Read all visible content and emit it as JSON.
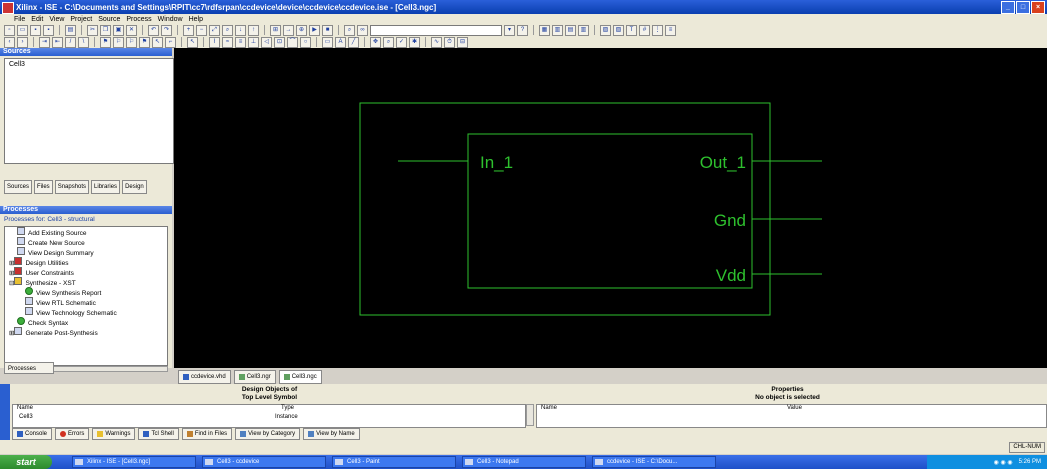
{
  "window": {
    "title": "Xilinx - ISE - C:\\Documents and Settings\\RPIT\\cc7\\rdfsrpan\\ccdevice\\device\\ccdevice\\ccdevice.ise - [Cell3.ngc]"
  },
  "menu": {
    "items": [
      "File",
      "Edit",
      "View",
      "Project",
      "Source",
      "Process",
      "Window",
      "Help"
    ]
  },
  "sources": {
    "header": "Sources",
    "items": [
      "Cell3"
    ],
    "tabs": [
      "Sources",
      "Files",
      "Snapshots",
      "Libraries",
      "Design"
    ]
  },
  "processes": {
    "header": "Processes",
    "title": "Processes for: Cell3 - structural",
    "items": [
      {
        "label": "Add Existing Source",
        "icon": "doc"
      },
      {
        "label": "Create New Source",
        "icon": "doc"
      },
      {
        "label": "View Design Summary",
        "icon": "doc"
      },
      {
        "label": "Design Utilities",
        "icon": "red"
      },
      {
        "label": "User Constraints",
        "icon": "red"
      },
      {
        "label": "Synthesize - XST",
        "icon": "warn"
      },
      {
        "label": "View Synthesis Report",
        "icon": "ok"
      },
      {
        "label": "View RTL Schematic",
        "icon": "doc"
      },
      {
        "label": "View Technology Schematic",
        "icon": "doc"
      },
      {
        "label": "Check Syntax",
        "icon": "ok"
      },
      {
        "label": "Generate Post-Synthesis",
        "icon": "doc"
      }
    ],
    "tab": "Processes"
  },
  "schematic": {
    "ports": {
      "in1": "In_1",
      "out1": "Out_1",
      "gnd": "Gnd",
      "vdd": "Vdd"
    },
    "line_color": "#2ec02e"
  },
  "doc_tabs": [
    "ccdevice.vhd",
    "Cell3.ngr",
    "Cell3.ngc"
  ],
  "design_objects": {
    "title_line1": "Design Objects of",
    "title_line2": "Top Level Symbol",
    "col_name": "Name",
    "col_type": "Type",
    "row_name": "Cell3",
    "row_type": "Instance"
  },
  "properties": {
    "title_line1": "Properties",
    "title_line2": "No object is selected",
    "col_name": "Name",
    "col_value": "Value"
  },
  "console_tabs": [
    "Console",
    "Errors",
    "Warnings",
    "Tcl Shell",
    "Find in Files",
    "View by Category",
    "View by Name"
  ],
  "status": {
    "right": "CHL-NUM"
  },
  "taskbar": {
    "start": "start",
    "tasks": [
      "Xilinx - ISE - [Cell3.ngc]",
      "Cell3 - ccdevice",
      "Cell3 - Paint",
      "Cell3 - Notepad",
      "ccdevice - ISE - C:\\Docu..."
    ],
    "time": "5:26 PM"
  }
}
